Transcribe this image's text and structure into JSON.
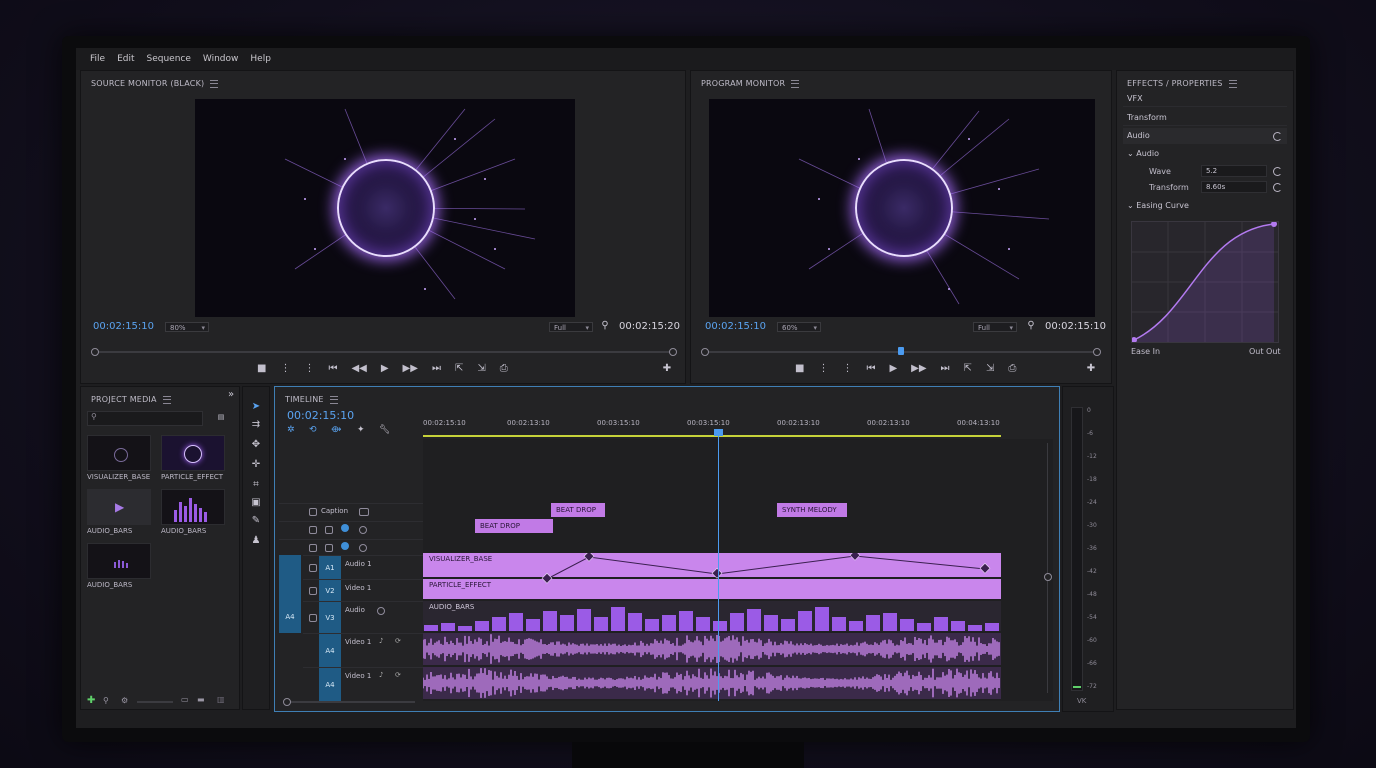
{
  "menu": [
    "File",
    "Edit",
    "Sequence",
    "Window",
    "Help"
  ],
  "source_monitor": {
    "title": "SOURCE MONITOR (BLACK)",
    "timecode_left": "00:02:15:10",
    "zoom": "80%",
    "quality": "Full",
    "timecode_right": "00:02:15:20"
  },
  "program_monitor": {
    "title": "PROGRAM MONITOR",
    "timecode_left": "00:02:15:10",
    "zoom": "60%",
    "quality": "Full",
    "timecode_right": "00:02:15:10",
    "playhead_fraction": 0.5
  },
  "transport_glyphs": {
    "stop": "■",
    "marker_in": "⋮",
    "marker_out": "⋮",
    "step_back": "⏮",
    "rewind": "◀◀",
    "play": "▶",
    "forward": "▶▶",
    "step_fwd": "⏭",
    "lift": "⇱",
    "extract": "⇲",
    "export": "⎙",
    "add": "✚"
  },
  "effects": {
    "title": "EFFECTS / PROPERTIES",
    "rows": [
      "VFX",
      "Transform",
      "Audio"
    ],
    "audio_group": "Audio",
    "props": [
      {
        "label": "Wave",
        "value": "5.2"
      },
      {
        "label": "Transform",
        "value": "8.60s"
      }
    ],
    "easing_group": "Easing Curve",
    "ease_in": "Ease In",
    "ease_out": "Out Out"
  },
  "project_media": {
    "title": "PROJECT MEDIA",
    "search_placeholder": "",
    "items": [
      "VISUALIZER_BASE",
      "PARTICLE_EFFECT",
      "AUDIO_BARS",
      "AUDIO_BARS",
      "AUDIO_BARS"
    ]
  },
  "timeline": {
    "title": "TIMELINE",
    "timecode": "00:02:15:10",
    "ruler": [
      "00:02:15:10",
      "00:02:13:10",
      "00:03:15:10",
      "00:03:15:10",
      "00:02:13:10",
      "00:02:13:10",
      "00:04:13:10"
    ],
    "caption_track": "Caption",
    "markers": [
      {
        "label": "BEAT DROP"
      },
      {
        "label": "SYNTH MELODY"
      },
      {
        "label": "BEAT DROP"
      }
    ],
    "tracks": [
      {
        "badge_left": "",
        "badge": "A1",
        "name": "Audio 1"
      },
      {
        "badge_left": "",
        "badge": "V2",
        "name": "Video 1"
      },
      {
        "badge_left": "A4",
        "badge": "V3",
        "name": "Audio"
      },
      {
        "badge_left": "",
        "badge": "A4",
        "name": "Video 1"
      },
      {
        "badge_left": "",
        "badge": "A4",
        "name": "Video 1"
      }
    ],
    "clips": {
      "visualizer": "VISUALIZER_BASE",
      "particle": "PARTICLE_EFFECT",
      "audio_bars": "AUDIO_BARS"
    }
  },
  "vu_meter": {
    "ticks": [
      "0",
      "-6",
      "-12",
      "-18",
      "-24",
      "-30",
      "-36",
      "-42",
      "-48",
      "-54",
      "-60",
      "-66",
      "-72"
    ],
    "label": "VK"
  }
}
